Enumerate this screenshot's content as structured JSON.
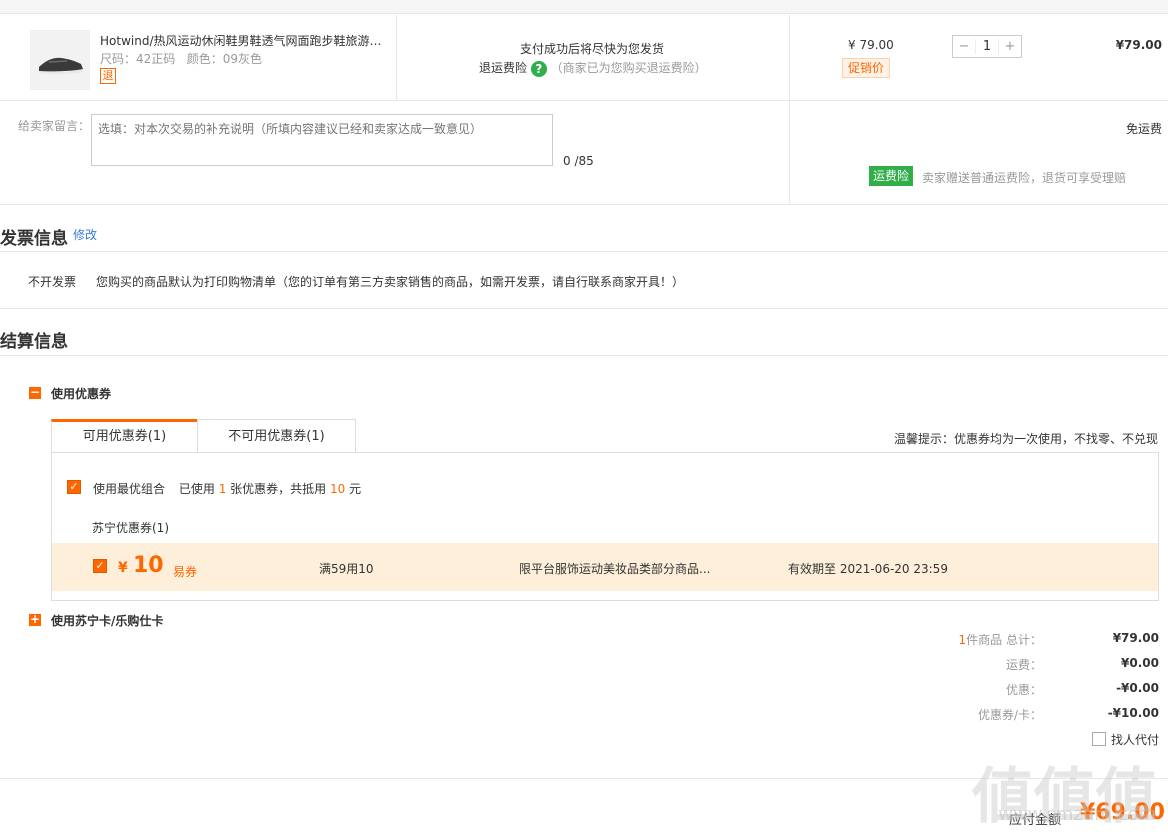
{
  "product": {
    "name": "Hotwind/热风运动休闲鞋男鞋透气网面跑步鞋旅游…",
    "attrs": "尺码：42正码   颜色：09灰色",
    "return_tag": "退",
    "ship_notice": "支付成功后将尽快为您发货",
    "insurance_label": "退运费险",
    "insurance_help_icon": "?",
    "insurance_note": "（商家已为您购买退运费险）",
    "unit_price": "¥ 79.00",
    "promo_tag": "促销价",
    "qty_minus": "−",
    "qty": "1",
    "qty_plus": "+",
    "subtotal": "¥79.00"
  },
  "message": {
    "label": "给卖家留言：",
    "placeholder": "选填：对本次交易的补充说明（所填内容建议已经和卖家达成一致意见）",
    "counter": "0 /85"
  },
  "shipping": {
    "free": "免运费",
    "tag": "运费险",
    "note": "卖家赠送普通运费险，退货可享受理赔"
  },
  "invoice": {
    "title": "发票信息",
    "edit": "修改",
    "type": "不开发票",
    "note": "您购买的商品默认为打印购物清单（您的订单有第三方卖家销售的商品，如需开发票，请自行联系商家开具！）"
  },
  "settlement": {
    "title": "结算信息",
    "coupon_section": "使用优惠券",
    "coupon_section_icon": "−",
    "tabs": [
      "可用优惠券(1)",
      "不可用优惠券(1)"
    ],
    "tip": "温馨提示：优惠券均为一次使用，不找零、不兑现",
    "best_combo": "使用最优组合",
    "used_pre": "已使用",
    "used_count": "1",
    "used_mid": "张优惠券，共抵用",
    "used_amount": "10",
    "used_unit": "元",
    "group": "苏宁优惠券(1)",
    "coupon": {
      "currency": "¥",
      "amount": "10",
      "type": "易券",
      "condition": "满59用10",
      "scope": "限平台服饰运动美妆品类部分商品...",
      "expiry": "有效期至 2021-06-20 23:59"
    },
    "card_section": "使用苏宁卡/乐购仕卡",
    "card_section_icon": "+"
  },
  "summary": {
    "count": "1",
    "items_label": "件商品 总计：",
    "items_total": "¥79.00",
    "freight_label": "运费：",
    "freight": "¥0.00",
    "discount_label": "优惠：",
    "discount": "-¥0.00",
    "coupon_label": "优惠券/卡：",
    "coupon_value": "-¥10.00",
    "proxy_pay": "找人代付",
    "payable_label": "应付金额",
    "payable": "¥69.00"
  },
  "watermark": {
    "chars": "値値値",
    "url": "www.smzdm.com"
  },
  "colors": {
    "accent": "#ff6600",
    "green": "#2fae4a",
    "link": "#3a7bd5"
  }
}
